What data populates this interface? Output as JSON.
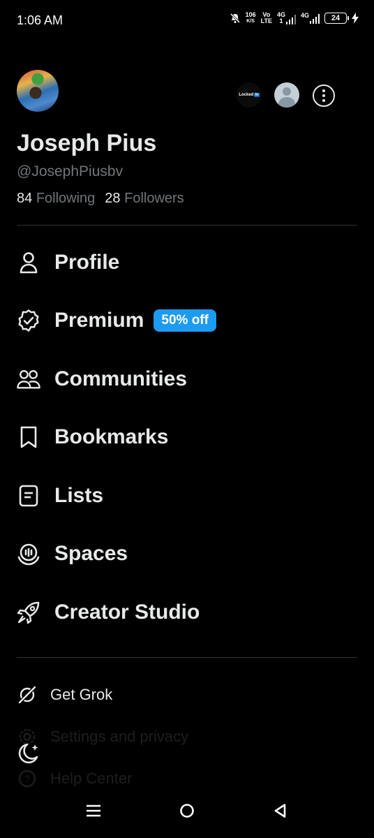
{
  "status_bar": {
    "time": "1:06 AM",
    "net_speed_top": "106",
    "net_speed_bottom": "K/S",
    "volte_top": "Vo",
    "volte_bottom": "LTE",
    "sim1_top": "4G",
    "sim1_bottom": "1",
    "sim2": "4G",
    "battery": "24"
  },
  "profile": {
    "name": "Joseph Pius",
    "handle": "@JosephPiusbv",
    "following_count": "84",
    "following_label": "Following",
    "followers_count": "28",
    "followers_label": "Followers",
    "other_account_label": "Locked",
    "other_account_in": "in"
  },
  "menu": {
    "items": [
      {
        "label": "Profile",
        "icon": "person-icon"
      },
      {
        "label": "Premium",
        "icon": "verified-badge-icon",
        "badge": "50% off"
      },
      {
        "label": "Communities",
        "icon": "communities-icon"
      },
      {
        "label": "Bookmarks",
        "icon": "bookmark-icon"
      },
      {
        "label": "Lists",
        "icon": "lists-icon"
      },
      {
        "label": "Spaces",
        "icon": "spaces-icon"
      },
      {
        "label": "Creator Studio",
        "icon": "rocket-icon"
      }
    ]
  },
  "secondary": {
    "grok": "Get Grok",
    "settings": "Settings and privacy",
    "help": "Help Center"
  },
  "colors": {
    "background": "#000000",
    "text": "#e7e9ea",
    "muted": "#71767b",
    "accent": "#1d9bf0",
    "divider": "#2f3336"
  }
}
